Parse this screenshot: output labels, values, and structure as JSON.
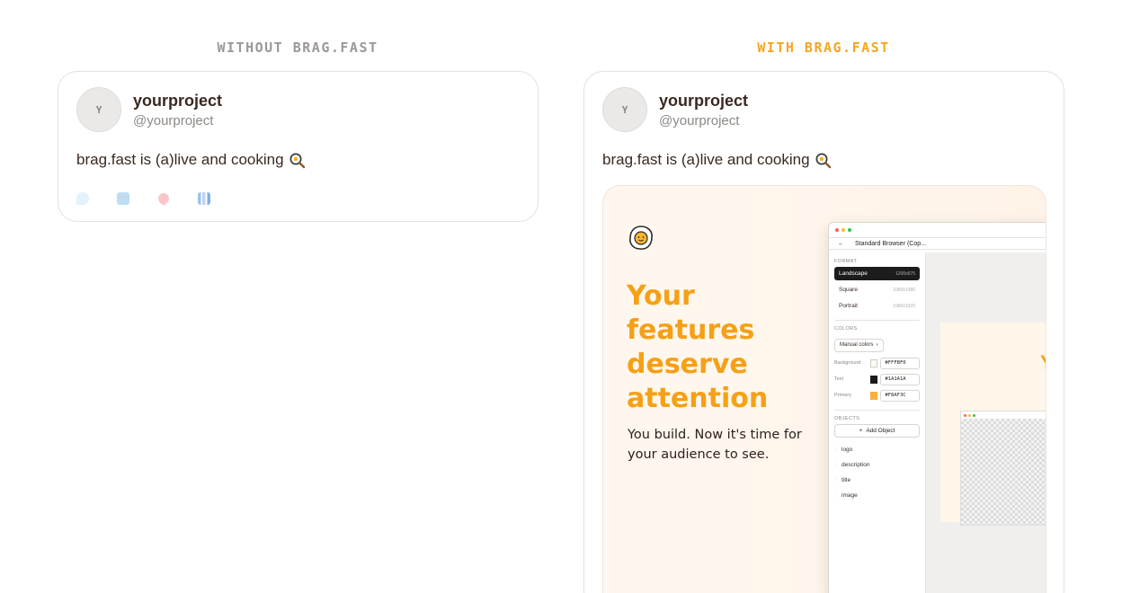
{
  "labels": {
    "without": "WITHOUT BRAG.FAST",
    "with": "WITH BRAG.FAST"
  },
  "tweet": {
    "avatar_letter": "Y",
    "name": "yourproject",
    "handle": "@yourproject",
    "text": "brag.fast is (a)live and cooking"
  },
  "actions": [
    {
      "icon": "comment-icon",
      "color": "#cfe8f7"
    },
    {
      "icon": "retweet-icon",
      "color": "#bcdcf2"
    },
    {
      "icon": "heart-icon",
      "color": "#f7c6c9"
    },
    {
      "icon": "stats-icon",
      "color": "#bcd3f2"
    }
  ],
  "preview": {
    "title": "Your features deserve attention",
    "subtitle": "You build. Now it's time for your audience to see.",
    "accent": "#F5A015",
    "mock": {
      "tab_title": "Standard Browser (Cop...",
      "format_label": "FORMAT",
      "formats": [
        {
          "name": "Landscape",
          "dim": "1200x675",
          "active": true
        },
        {
          "name": "Square",
          "dim": "1080x1080",
          "active": false
        },
        {
          "name": "Portrait",
          "dim": "1080x1920",
          "active": false
        }
      ],
      "colors_label": "COLORS",
      "color_mode": "Manual colors",
      "colors": [
        {
          "label": "Background",
          "hex": "#FFFBF0",
          "swatch": "#FFFBF0"
        },
        {
          "label": "Text",
          "hex": "#1A1A1A",
          "swatch": "#1A1A1A"
        },
        {
          "label": "Primary",
          "hex": "#F8AF3C",
          "swatch": "#F8AF3C"
        }
      ],
      "objects_label": "OBJECTS",
      "add_object": "Add Object",
      "objects": [
        "logo",
        "description",
        "title",
        "image"
      ],
      "canvas_glyph": "Y"
    }
  }
}
